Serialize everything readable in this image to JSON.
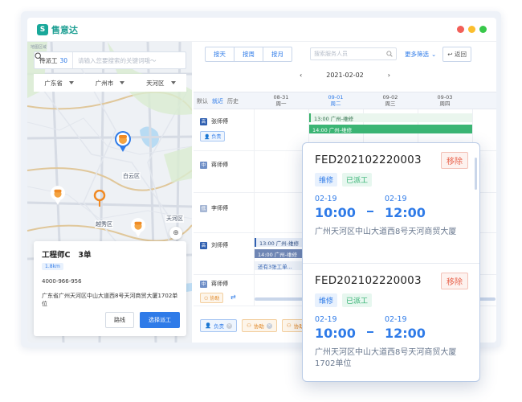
{
  "app": {
    "logo_text": "售意达",
    "logo_mark": "S"
  },
  "window_dots": [
    "#f25f58",
    "#fbbe2e",
    "#38c84a"
  ],
  "map_panel": {
    "tiny_label": "地图区域",
    "tab_label": "待派工",
    "tab_count": "30",
    "search_placeholder": "请输入您要搜索的关键词哦～",
    "regions": [
      "广东省",
      "广州市",
      "天河区"
    ],
    "labels": {
      "baiyun": "白云区",
      "tianhe": "天河区",
      "yuexiu": "越秀区"
    }
  },
  "engineer_card": {
    "name": "工程师C",
    "orders": "3单",
    "distance": "1.8km",
    "phone": "4000-966-956",
    "address": "广东省广州天河区中山大道西8号天河商贸大厦1702单位",
    "route_button": "路线",
    "dispatch_button": "选择派工"
  },
  "toolbar": {
    "views": [
      "按天",
      "按周",
      "按月"
    ],
    "search_placeholder": "搜索服务人员",
    "more_filter": "更多筛选",
    "back": "返回"
  },
  "date_nav": {
    "current": "2021-02-02"
  },
  "filters": {
    "default": "默认",
    "nearby": "就近",
    "history": "历史"
  },
  "day_columns": [
    {
      "date": "08-31",
      "weekday": "周一"
    },
    {
      "date": "09-01",
      "weekday": "周二"
    },
    {
      "date": "09-02",
      "weekday": "周三"
    },
    {
      "date": "09-03",
      "weekday": "周四"
    }
  ],
  "workers": [
    {
      "level": "高",
      "name": "张师傅",
      "tag": "负责"
    },
    {
      "level": "中",
      "name": "蒋师傅",
      "tag": ""
    },
    {
      "level": "低",
      "name": "李师傅",
      "tag": ""
    },
    {
      "level": "高",
      "name": "刘师傅",
      "tag": ""
    },
    {
      "level": "中",
      "name": "蒋师傅",
      "tag": "协助"
    }
  ],
  "slots": {
    "zhang_1": "13:00 广州-维修",
    "zhang_2": "14:00 广州-维修",
    "liu_1": "13:00 广州-维修",
    "liu_2": "14:00 广州-维修",
    "liu_more": "还有3张工单..."
  },
  "footer_tags": {
    "charge": "负责",
    "assist": "协助"
  },
  "popup_orders": [
    {
      "id": "FED202102220003",
      "remove": "移除",
      "type": "维修",
      "status": "已派工",
      "start_date": "02-19",
      "start_time": "10:00",
      "end_date": "02-19",
      "end_time": "12:00",
      "address": "广州天河区中山大道西8号天河商贸大厦"
    },
    {
      "id": "FED202102220003",
      "remove": "移除",
      "type": "维修",
      "status": "已派工",
      "start_date": "02-19",
      "start_time": "10:00",
      "end_date": "02-19",
      "end_time": "12:00",
      "address": "广州天河区中山大道西8号天河商贸大厦1702单位"
    }
  ],
  "icons": [
    "logo-icon",
    "search-icon",
    "caret-down-icon",
    "engineer-pin-icon",
    "location-pin-icon",
    "locate-icon",
    "chevron-left-icon",
    "chevron-right-icon",
    "back-icon",
    "user-icon",
    "assist-icon",
    "swap-icon",
    "close-icon"
  ]
}
